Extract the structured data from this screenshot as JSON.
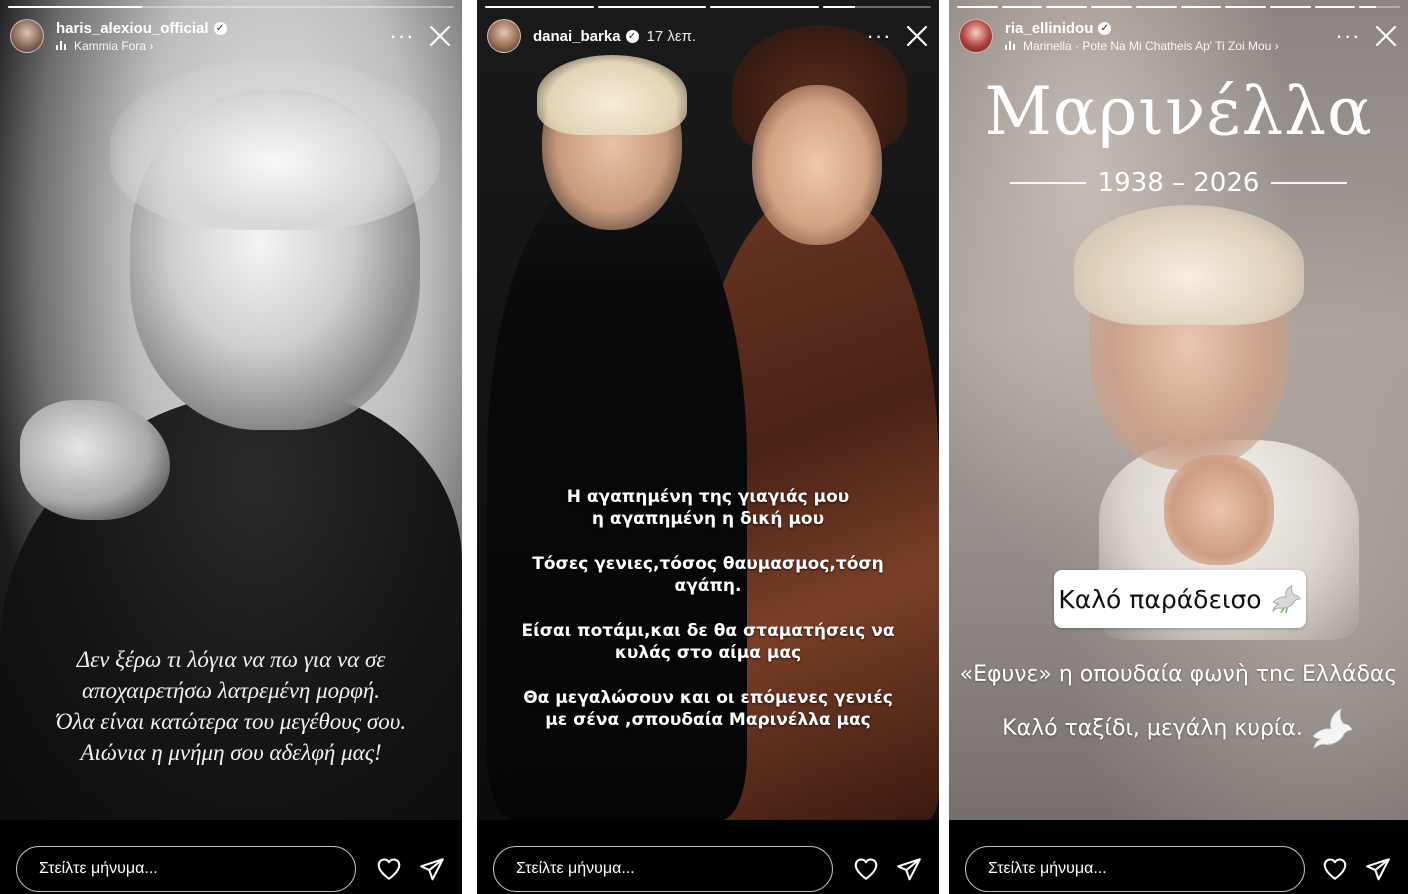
{
  "stories": [
    {
      "username": "haris_alexiou_official",
      "music": "Kammia Fora ›",
      "caption_lines": [
        "Δεν ξέρω τι λόγια να πω για να σε",
        "αποχαιρετήσω λατρεμένη μορφή.",
        "Όλα είναι κατώτερα του μεγέθους σου.",
        "Αιώνια η μνήμη σου αδελφή μας!"
      ],
      "message_placeholder": "Στείλτε μήνυμα...",
      "progress": [
        0.3
      ]
    },
    {
      "username": "danai_barka",
      "time": "17 λεπ.",
      "caption_paragraphs": [
        [
          "Η αγαπημένη της γιαγιάς μου",
          "η αγαπημένη η δική μου"
        ],
        [
          "Τόσες γενιες,τόσος θαυμασμος,τόση",
          "αγάπη."
        ],
        [
          "Είσαι ποτάμι,και δε θα σταματήσεις να",
          "κυλάς στο αίμα μας"
        ],
        [
          "Θα μεγαλώσουν και οι επόμενες γενιές",
          "με σένα ,σπουδαία Μαρινέλλα μας"
        ]
      ],
      "message_placeholder": "Στείλτε μήνυμα...",
      "progress": [
        1,
        1,
        1,
        0.3
      ]
    },
    {
      "username": "ria_ellinidou",
      "music": "Marinella · Pote Na Mi Chatheis Ap' Ti Zoi Mou ›",
      "title": "Μαρινέλλα",
      "years": "1938 – 2026",
      "sticker": "Καλό παράδεισο",
      "line1": "«Εφυνε» η οπουδαία φωνὴ τnc Ελλάδας",
      "line2": "Καλό ταξίδι, μεγάλη κυρία.",
      "message_placeholder": "Στείλτε μήνυμα...",
      "progress": [
        1,
        1,
        1,
        1,
        1,
        1,
        1,
        1,
        1,
        0.4
      ]
    }
  ],
  "icons": {
    "verified": "verified-badge-icon",
    "more": "more-options-icon",
    "close": "close-icon",
    "music": "music-bars-icon",
    "heart": "heart-icon",
    "send": "send-icon",
    "dove": "dove-icon"
  },
  "colors": {
    "background": "#000000",
    "text": "#ffffff",
    "page": "#ffffff"
  }
}
